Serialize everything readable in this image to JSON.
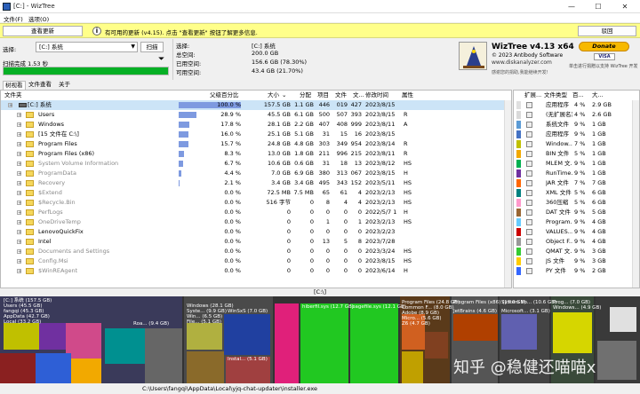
{
  "window": {
    "title": "[C:] - WizTree",
    "min": "—",
    "max": "☐",
    "close": "✕"
  },
  "menu": [
    "文件(F)",
    "选项(O)"
  ],
  "notify": {
    "check_update": "查看更新",
    "message": "有可用的更新 (v4.15). 点击 \"查看更新\" 按钮了解更多信息.",
    "close": "驳回"
  },
  "scan": {
    "select_label": "选择:",
    "drive_value": "[C:] 系统",
    "scan_button": "扫描",
    "complete": "扫描完成 1.53 秒",
    "progress": 1.0
  },
  "drive_info": {
    "select_label": "选择:",
    "drive": "[C:] 系统",
    "labels": [
      "总空间:",
      "已用空间:",
      "可用空间:"
    ],
    "values": [
      "200.0 GB",
      "156.6 GB  (78.30%)",
      "43.4 GB  (21.70%)"
    ]
  },
  "about": {
    "name": "WizTree v4.13 x64",
    "copyright": "© 2023 Antibody Software",
    "site": "www.diskanalyzer.com",
    "help": "感谢您的捐助,我能继续开发!",
    "donate": "Donate",
    "help2": "单击进行捐赠以支持 WizTree 开发",
    "cards": "VISA"
  },
  "tabs": [
    "树视看",
    "文件查看",
    "关于"
  ],
  "tree": {
    "headers": [
      "文件夹",
      "父级百分比",
      "大小",
      "分配",
      "项目",
      "文件",
      "文...",
      "修改时间",
      "属性"
    ],
    "rows": [
      {
        "name": "[C:] 系统",
        "pct": "100.0 %",
        "pctv": 1.0,
        "size": "157.5 GB",
        "alloc": "1.1 GB",
        "items": "446",
        "files": "019",
        "fold": "427",
        "date": "2023/8/15",
        "attr": "",
        "indent": 0,
        "gray": false,
        "sel": true
      },
      {
        "name": "Users",
        "pct": "28.9 %",
        "pctv": 0.289,
        "size": "45.5 GB",
        "alloc": "6.1 GB",
        "items": "500",
        "files": "507",
        "fold": "393",
        "date": "2023/8/15",
        "attr": "R",
        "indent": 1,
        "gray": false,
        "sel": false
      },
      {
        "name": "Windows",
        "pct": "17.8 %",
        "pctv": 0.178,
        "size": "28.1 GB",
        "alloc": "2.2 GB",
        "items": "407",
        "files": "408",
        "fold": "999",
        "date": "2023/8/11",
        "attr": "A",
        "indent": 1,
        "gray": false,
        "sel": false
      },
      {
        "name": "[15 文件在 C:\\]",
        "pct": "16.0 %",
        "pctv": 0.16,
        "size": "25.1 GB",
        "alloc": "5.1 GB",
        "items": "31",
        "files": "15",
        "fold": "16",
        "date": "2023/8/15",
        "attr": "",
        "indent": 1,
        "gray": false,
        "sel": false
      },
      {
        "name": "Program Files",
        "pct": "15.7 %",
        "pctv": 0.157,
        "size": "24.8 GB",
        "alloc": "4.8 GB",
        "items": "303",
        "files": "349",
        "fold": "954",
        "date": "2023/8/14",
        "attr": "R",
        "indent": 1,
        "gray": false,
        "sel": false
      },
      {
        "name": "Program Files (x86)",
        "pct": "8.3 %",
        "pctv": 0.083,
        "size": "13.0 GB",
        "alloc": "1.8 GB",
        "items": "211",
        "files": "996",
        "fold": "215",
        "date": "2023/8/11",
        "attr": "R",
        "indent": 1,
        "gray": false,
        "sel": false
      },
      {
        "name": "System Volume Information",
        "pct": "6.7 %",
        "pctv": 0.067,
        "size": "10.6 GB",
        "alloc": "0.6 GB",
        "items": "31",
        "files": "18",
        "fold": "13",
        "date": "2023/8/12",
        "attr": "HS",
        "indent": 1,
        "gray": true,
        "sel": false
      },
      {
        "name": "ProgramData",
        "pct": "4.4 %",
        "pctv": 0.044,
        "size": "7.0 GB",
        "alloc": "6.9 GB",
        "items": "380",
        "files": "313",
        "fold": "067",
        "date": "2023/8/15",
        "attr": "H",
        "indent": 1,
        "gray": true,
        "sel": false
      },
      {
        "name": "Recovery",
        "pct": "2.1 %",
        "pctv": 0.021,
        "size": "3.4 GB",
        "alloc": "3.4 GB",
        "items": "495",
        "files": "343",
        "fold": "152",
        "date": "2023/5/11",
        "attr": "HS",
        "indent": 1,
        "gray": true,
        "sel": false
      },
      {
        "name": "$Extend",
        "pct": "0.0 %",
        "pctv": 0.0,
        "size": "72.5 MB",
        "alloc": "7.5 MB",
        "items": "65",
        "files": "61",
        "fold": "4",
        "date": "2023/2/13",
        "attr": "HS",
        "indent": 1,
        "gray": true,
        "sel": false
      },
      {
        "name": "$Recycle.Bin",
        "pct": "0.0 %",
        "pctv": 0.0,
        "size": "516 字节",
        "alloc": "0",
        "items": "8",
        "files": "4",
        "fold": "4",
        "date": "2023/2/13",
        "attr": "HS",
        "indent": 1,
        "gray": true,
        "sel": false
      },
      {
        "name": "PerfLogs",
        "pct": "0.0 %",
        "pctv": 0.0,
        "size": "0",
        "alloc": "0",
        "items": "0",
        "files": "0",
        "fold": "0",
        "date": "2022/5/7 1",
        "attr": "H",
        "indent": 1,
        "gray": true,
        "sel": false
      },
      {
        "name": "OneDriveTemp",
        "pct": "0.0 %",
        "pctv": 0.0,
        "size": "0",
        "alloc": "0",
        "items": "1",
        "files": "0",
        "fold": "1",
        "date": "2023/2/13",
        "attr": "HS",
        "indent": 1,
        "gray": true,
        "sel": false
      },
      {
        "name": "LenovoQuickFix",
        "pct": "0.0 %",
        "pctv": 0.0,
        "size": "0",
        "alloc": "0",
        "items": "0",
        "files": "0",
        "fold": "0",
        "date": "2023/2/23",
        "attr": "",
        "indent": 1,
        "gray": false,
        "sel": false
      },
      {
        "name": "Intel",
        "pct": "0.0 %",
        "pctv": 0.0,
        "size": "0",
        "alloc": "0",
        "items": "13",
        "files": "5",
        "fold": "8",
        "date": "2023/7/28",
        "attr": "",
        "indent": 1,
        "gray": false,
        "sel": false
      },
      {
        "name": "Documents and Settings",
        "pct": "0.0 %",
        "pctv": 0.0,
        "size": "0",
        "alloc": "0",
        "items": "0",
        "files": "0",
        "fold": "0",
        "date": "2023/3/24",
        "attr": "HS",
        "indent": 1,
        "gray": true,
        "sel": false
      },
      {
        "name": "Config.Msi",
        "pct": "0.0 %",
        "pctv": 0.0,
        "size": "0",
        "alloc": "0",
        "items": "0",
        "files": "0",
        "fold": "0",
        "date": "2023/8/15",
        "attr": "HS",
        "indent": 1,
        "gray": true,
        "sel": false
      },
      {
        "name": "$WinREAgent",
        "pct": "0.0 %",
        "pctv": 0.0,
        "size": "0",
        "alloc": "0",
        "items": "0",
        "files": "0",
        "fold": "0",
        "date": "2023/6/14",
        "attr": "H",
        "indent": 1,
        "gray": true,
        "sel": false
      }
    ]
  },
  "ext": {
    "headers": [
      "扩展...",
      "文件类型",
      "百...",
      "大..."
    ],
    "rows": [
      {
        "c": "#e0e0e0",
        "type": "应用程序",
        "pct": "4 %",
        "size": "2.9 GB"
      },
      {
        "c": "#d9d9d9",
        "type": "(无扩展名)",
        "pct": "4 %",
        "size": "2.6 GB"
      },
      {
        "c": "#5b9bd5",
        "type": "系统文件",
        "pct": "9 %",
        "size": "1 GB"
      },
      {
        "c": "#4472c4",
        "type": "应用程序",
        "pct": "9 %",
        "size": "1 GB"
      },
      {
        "c": "#c0c000",
        "type": "Window...",
        "pct": "7 %",
        "size": "1 GB"
      },
      {
        "c": "#f2a900",
        "type": "BIN 文件",
        "pct": "5 %",
        "size": "1 GB"
      },
      {
        "c": "#00b050",
        "type": "MLEM 文...",
        "pct": "9 %",
        "size": "1 GB"
      },
      {
        "c": "#7030a0",
        "type": "RunTime...",
        "pct": "9 %",
        "size": "1 GB"
      },
      {
        "c": "#ff6600",
        "type": "JAR 文件",
        "pct": "7 %",
        "size": "7 GB"
      },
      {
        "c": "#008080",
        "type": "XML 文件",
        "pct": "5 %",
        "size": "6 GB"
      },
      {
        "c": "#ff99cc",
        "type": "360压缩",
        "pct": "5 %",
        "size": "6 GB"
      },
      {
        "c": "#996633",
        "type": "DAT 文件",
        "pct": "9 %",
        "size": "5 GB"
      },
      {
        "c": "#66ccff",
        "type": "Program...",
        "pct": "9 %",
        "size": "4 GB"
      },
      {
        "c": "#cc0000",
        "type": "VALUES...",
        "pct": "9 %",
        "size": "4 GB"
      },
      {
        "c": "#999999",
        "type": "Object F...",
        "pct": "9 %",
        "size": "4 GB"
      },
      {
        "c": "#33cc33",
        "type": "QMAT 文...",
        "pct": "9 %",
        "size": "3 GB"
      },
      {
        "c": "#ffcc00",
        "type": "JS 文件",
        "pct": "9 %",
        "size": "3 GB"
      },
      {
        "c": "#3366ff",
        "type": "PY 文件",
        "pct": "9 %",
        "size": "2 GB"
      }
    ]
  },
  "path_label": "[C:\\]",
  "treemap_labels": [
    "[C:] 系统 (157.5 GB)",
    "Users (45.5 GB)",
    "fangqi (45.3 GB)",
    "AppData (42.7 GB)",
    "Local (33.2 GB)",
    "Roa... (9.4 GB)",
    "Windows (28.1 GB)",
    "Syste... (9.9 GB)",
    "Win... (6.5 GB)",
    "File... (5.1 GB)",
    "WinSxS (7.0 GB)",
    "Instal... (5.1 GB)",
    "hiberfil.sys (12.7 GB)",
    "pagefile.sys (12.1 GB)",
    "Program Files (24.8 GB)",
    "Common F... (8.0 GB)",
    "Adobe (8.9 GB)",
    "Micro... (5.6 GB)",
    "Z6 (4.7 GB)",
    "Program Files (x86) (13.0 GB)",
    "JetBrains (4.6 GB)",
    "Microsoft... (3.1 GB)",
    "System Vo... (10.6 GB)",
    "Prog... (7.0 GB)",
    "Windows... (4.9 GB)"
  ],
  "status_path": "C:\\Users\\fangqi\\AppData\\Local\\yjq-chat-updater\\installer.exe",
  "watermark": "知乎 @稳健还喵喵x"
}
